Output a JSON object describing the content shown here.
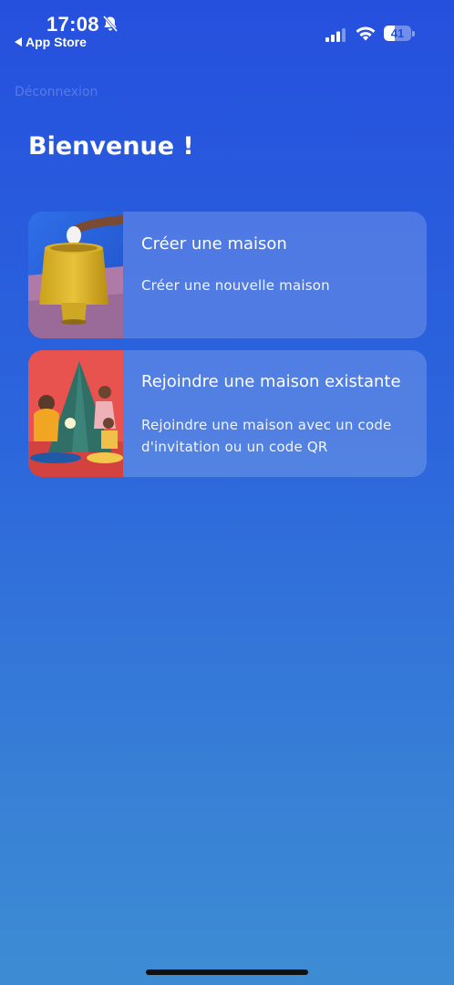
{
  "status_bar": {
    "time": "17:08",
    "back_label": "App Store",
    "battery_percent": "41",
    "battery_level": 0.41
  },
  "header": {
    "logout_label": "Déconnexion",
    "welcome": "Bienvenue !"
  },
  "cards": [
    {
      "title": "Créer une maison",
      "description": "Créer une nouvelle maison",
      "image_icon": "lamp-photo"
    },
    {
      "title": "Rejoindre une maison existante",
      "description": "Rejoindre une maison avec un code d'invitation ou un code QR",
      "image_icon": "family-tent-photo"
    }
  ],
  "colors": {
    "background_top": "#2550de",
    "background_bottom": "#3d8cd3",
    "card": "rgba(255,255,255,0.18)"
  }
}
